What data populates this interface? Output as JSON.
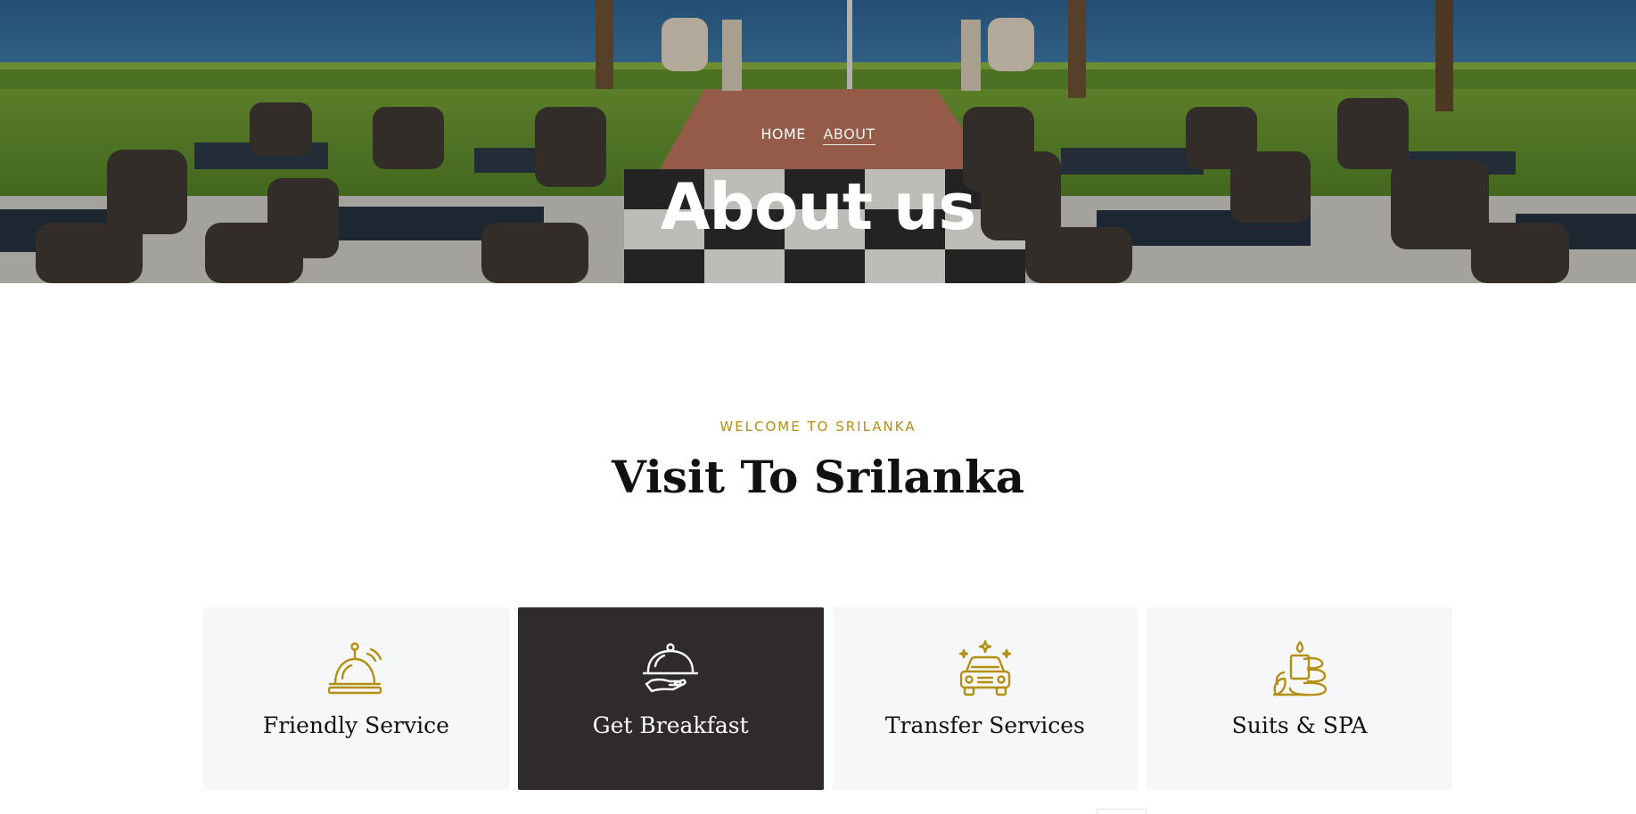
{
  "hero": {
    "breadcrumb": {
      "home": "HOME",
      "current": "ABOUT"
    },
    "title": "About us"
  },
  "intro": {
    "eyebrow": "WELCOME TO SRILANKA",
    "title": "Visit To Srilanka"
  },
  "services": [
    {
      "label": "Friendly Service",
      "icon": "service-bell-icon"
    },
    {
      "label": "Get Breakfast",
      "icon": "serving-cloche-icon"
    },
    {
      "label": "Transfer Services",
      "icon": "car-icon"
    },
    {
      "label": "Suits & SPA",
      "icon": "spa-candle-stones-icon"
    }
  ],
  "colors": {
    "accent": "#b38f14",
    "card_bg": "#f6f7f8",
    "card_active_bg": "#2f2a2c",
    "heading": "#111111"
  }
}
